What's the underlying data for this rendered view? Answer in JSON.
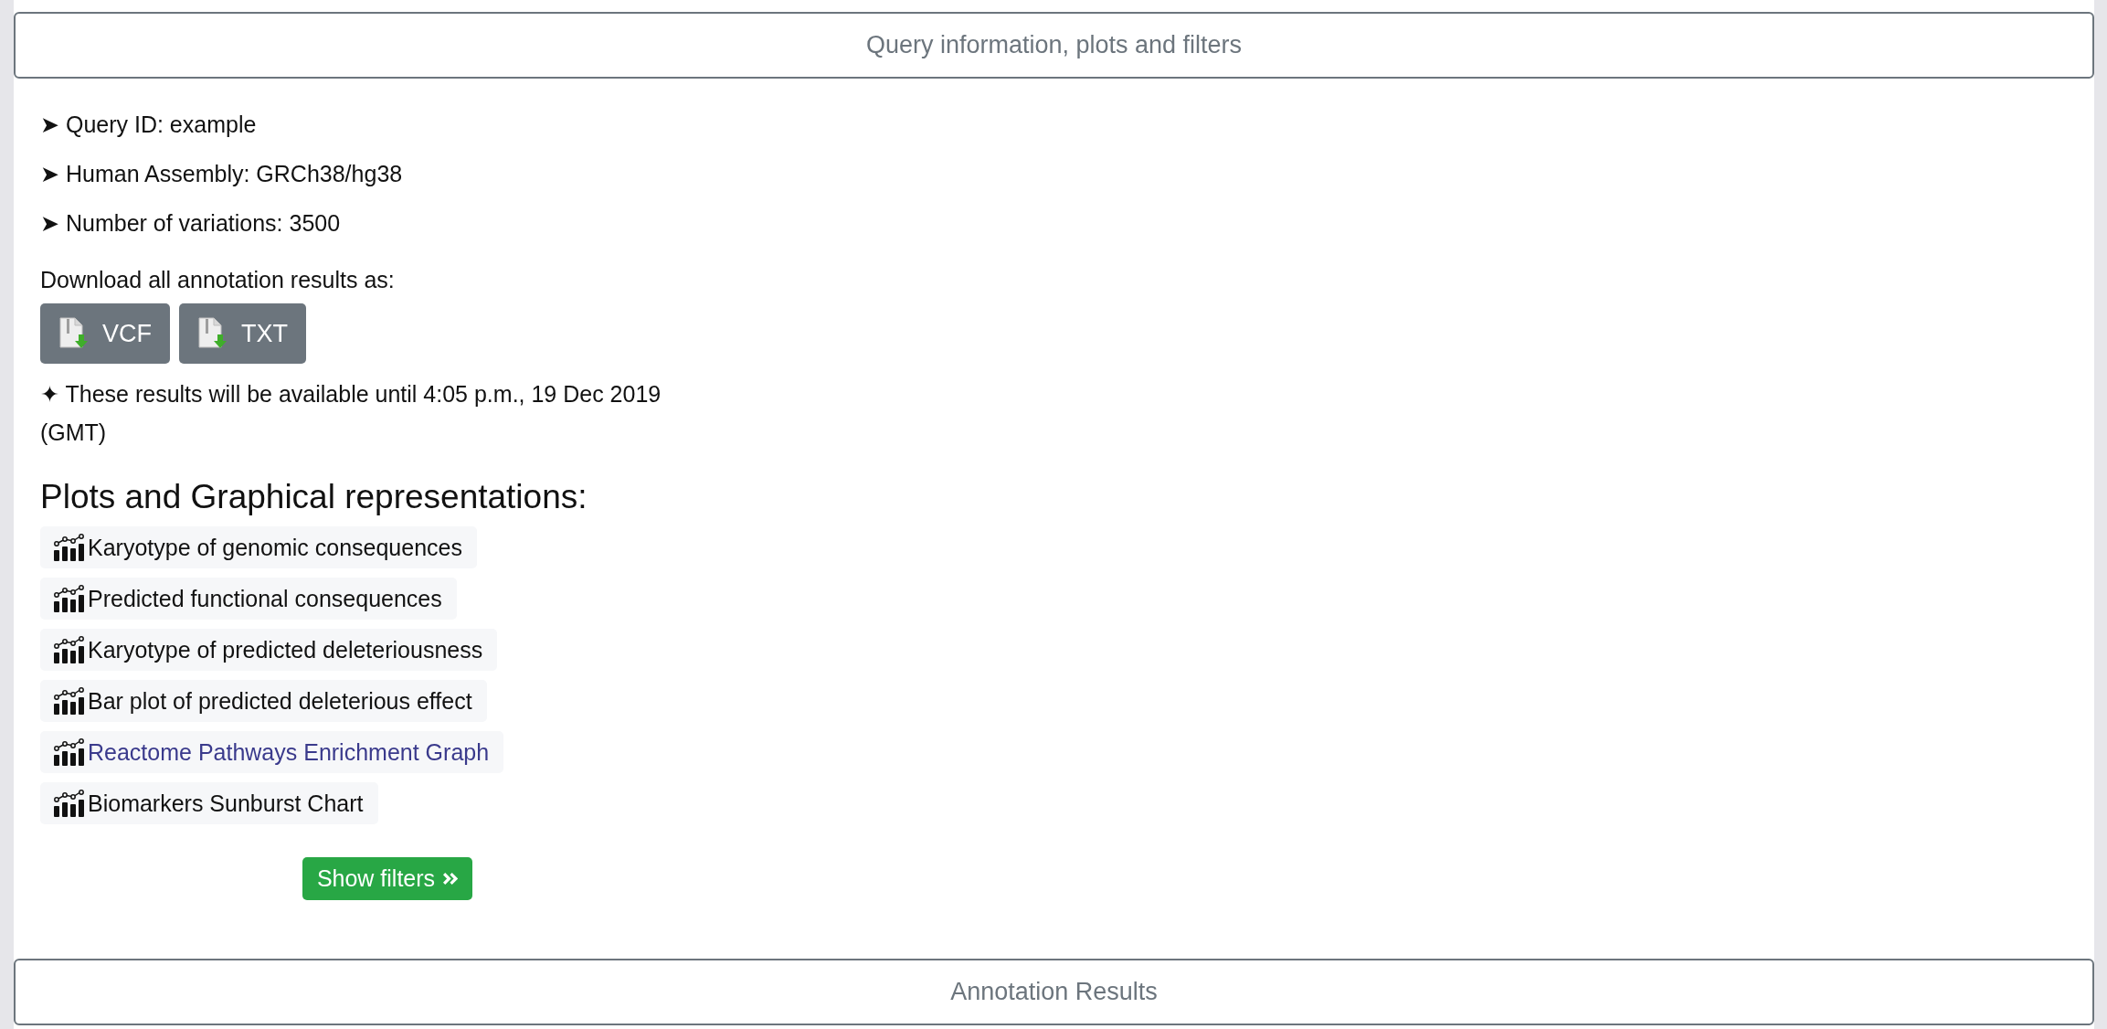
{
  "query_panel": {
    "title": "Query information, plots and filters"
  },
  "info": [
    "➤ Query ID: example",
    "➤ Human Assembly: GRCh38/hg38",
    "➤ Number of variations: 3500"
  ],
  "download": {
    "label": "Download all annotation results as:",
    "buttons": [
      "VCF",
      "TXT"
    ],
    "note": "✦ These results will be available until 4:05 p.m., 19 Dec 2019 (GMT)"
  },
  "plots": {
    "heading": "Plots and Graphical representations:",
    "items": [
      {
        "label": "Karyotype of genomic consequences",
        "visited": false
      },
      {
        "label": "Predicted functional consequences",
        "visited": false
      },
      {
        "label": "Karyotype of predicted deleteriousness",
        "visited": false
      },
      {
        "label": "Bar plot of predicted deleterious effect",
        "visited": false
      },
      {
        "label": "Reactome Pathways Enrichment Graph",
        "visited": true
      },
      {
        "label": "Biomarkers Sunburst Chart",
        "visited": false
      }
    ]
  },
  "filters_button": "Show filters",
  "results_panel": {
    "title": "Annotation Results"
  }
}
